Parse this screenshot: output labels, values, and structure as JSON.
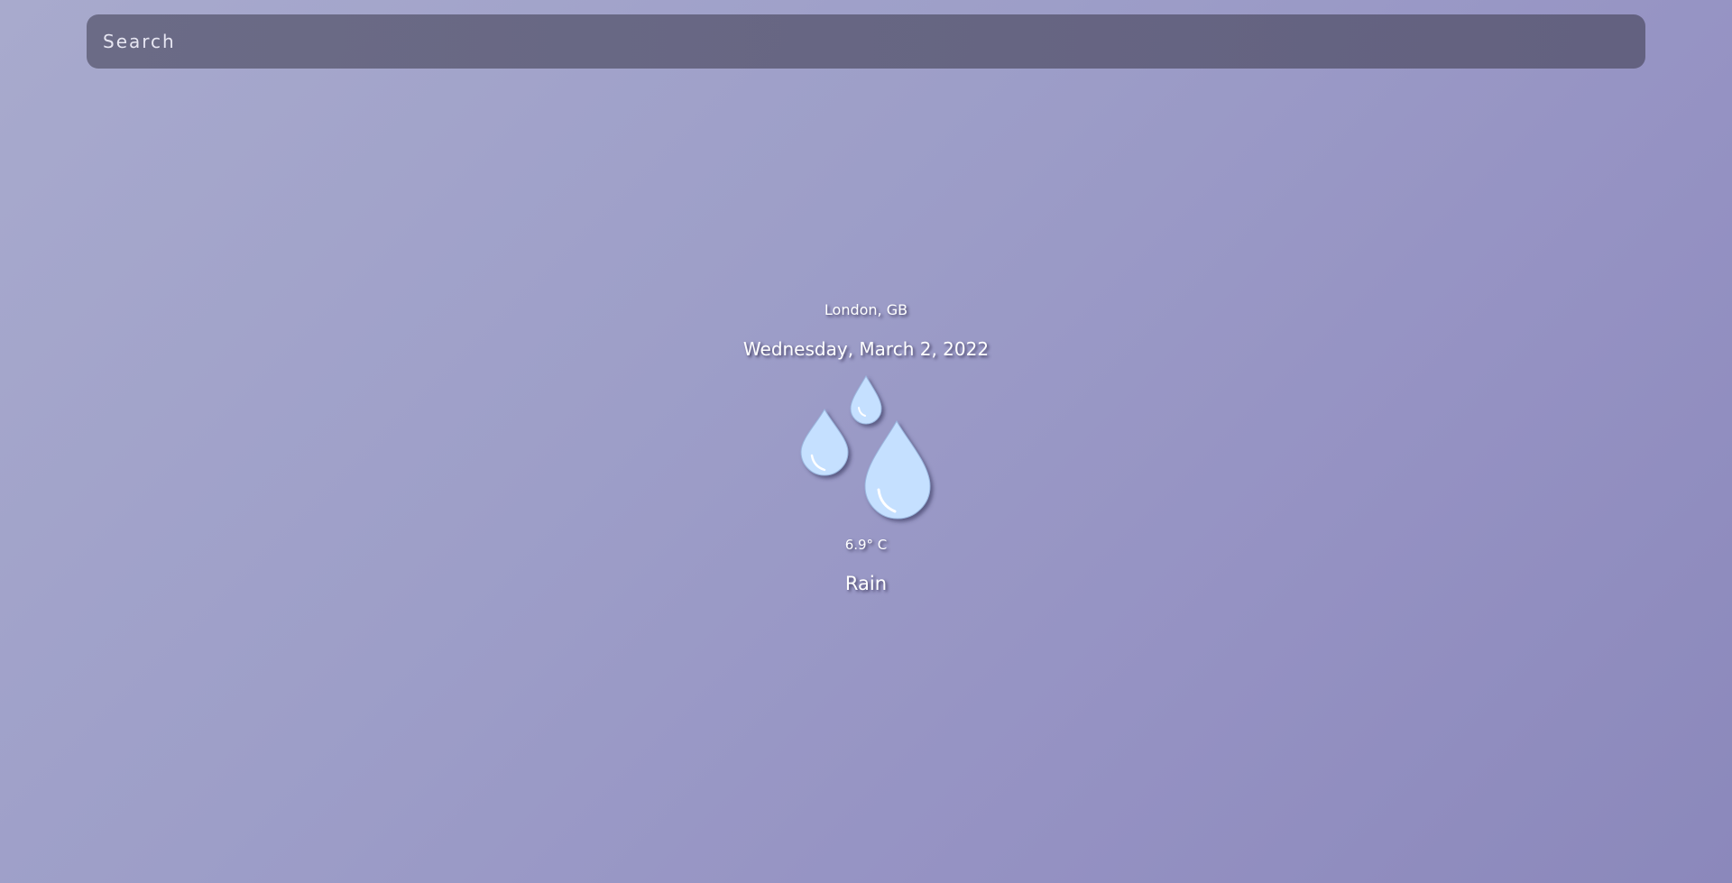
{
  "search": {
    "placeholder": "Search",
    "value": ""
  },
  "weather": {
    "location": "London, GB",
    "date": "Wednesday, March 2, 2022",
    "temperature": "6.9° C",
    "description": "Rain",
    "icon": "rain-drops-icon"
  },
  "colors": {
    "background_start": "#a8aacd",
    "background_end": "#8b88bb",
    "search_bar": "#646280",
    "text": "#ffffff",
    "drop_fill": "#c5e0ff"
  }
}
